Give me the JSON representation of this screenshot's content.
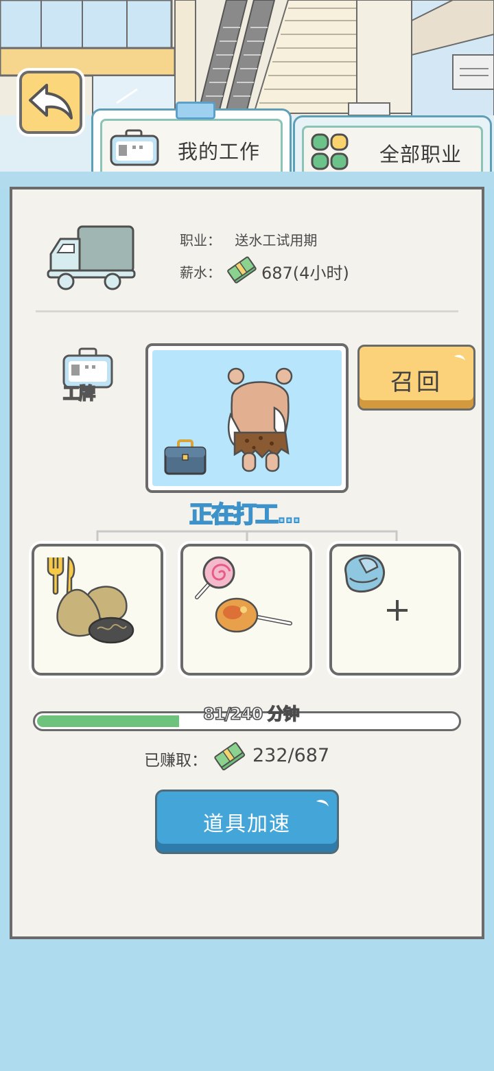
{
  "tabs": {
    "my_job": "我的工作",
    "all_jobs": "全部职业"
  },
  "job": {
    "occupation_label": "职业：",
    "occupation_value": "送水工试用期",
    "salary_label": "薪水：",
    "salary_value": "687(4小时)"
  },
  "badge_label": "工牌",
  "recall_button": "召回",
  "status_text": "正在打工...",
  "slots": [
    {
      "type_icon": "fork-knife-icon",
      "item": "potatoes-icon"
    },
    {
      "type_icon": "lollipop-icon",
      "item": "candy-lollipop-icon"
    },
    {
      "type_icon": "backpack-icon",
      "item": "add-plus-icon"
    }
  ],
  "progress": {
    "text": "81/240 分钟",
    "current": 81,
    "total": 240
  },
  "earned": {
    "label": "已赚取：",
    "value": "232/687"
  },
  "boost_button": "道具加速",
  "colors": {
    "background": "#aedcee",
    "panel": "#f4f2ed",
    "recall": "#fbd27a",
    "boost": "#44a6d8",
    "progress": "#6ec37c"
  }
}
